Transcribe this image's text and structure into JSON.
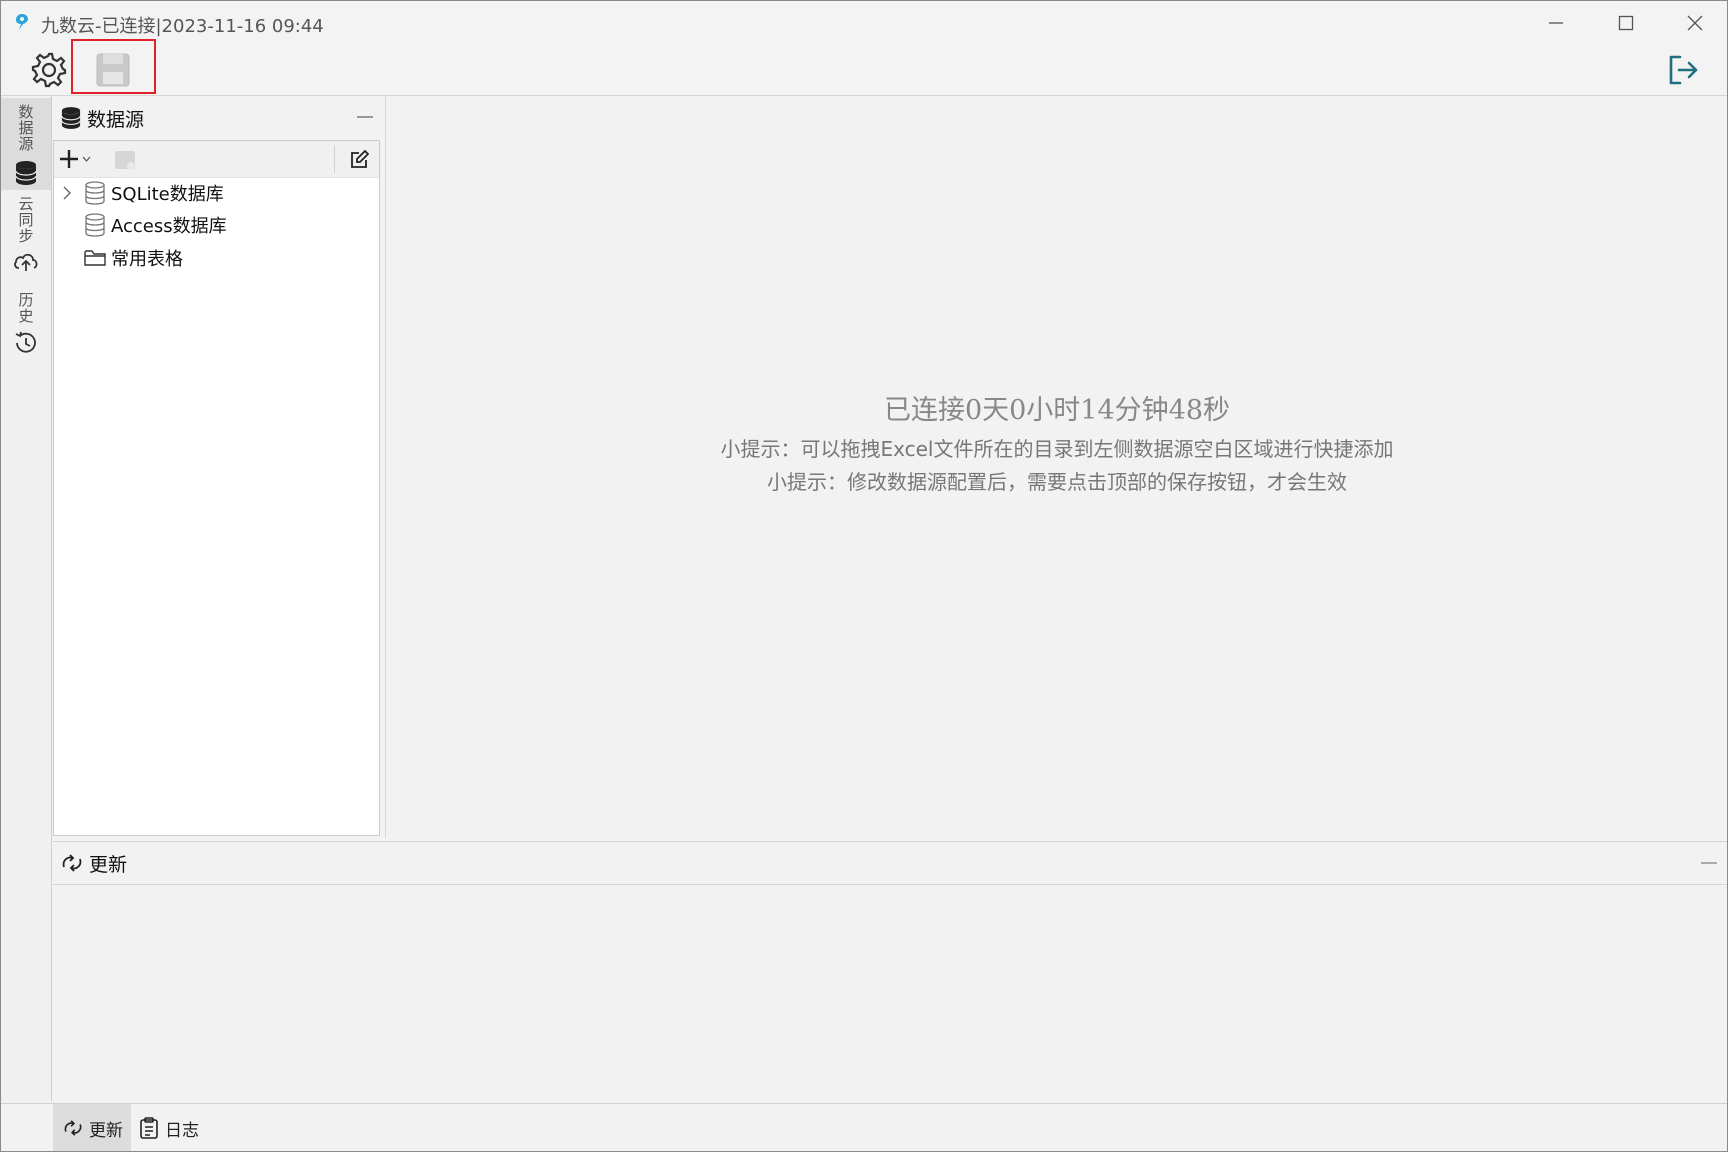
{
  "window": {
    "title": "九数云-已连接|2023-11-16 09:44",
    "controls": [
      "minimize-icon",
      "maximize-icon",
      "close-icon"
    ]
  },
  "toolbar": {
    "buttons": [
      "gear-icon",
      "save-icon"
    ],
    "right_button": "logout-icon",
    "highlight_color": "#e0202a"
  },
  "left_nav": {
    "tabs": [
      {
        "label": "数据源",
        "icon": "database-icon",
        "active": true
      },
      {
        "label": "云同步",
        "icon": "cloud-sync-icon",
        "active": false
      },
      {
        "label": "历史",
        "icon": "history-icon",
        "active": false
      }
    ]
  },
  "datasource_panel": {
    "title": "数据源",
    "tree": [
      {
        "label": "SQLite数据库",
        "icon": "database-icon",
        "expandable": true
      },
      {
        "label": "Access数据库",
        "icon": "database-icon",
        "expandable": false
      },
      {
        "label": "常用表格",
        "icon": "folder-icon",
        "expandable": false
      }
    ]
  },
  "main": {
    "status": "已连接0天0小时14分钟48秒",
    "hint1": "小提示：可以拖拽Excel文件所在的目录到左侧数据源空白区域进行快捷添加",
    "hint2": "小提示：修改数据源配置后，需要点击顶部的保存按钮，才会生效"
  },
  "update_panel": {
    "title": "更新"
  },
  "bottom_tabs": [
    {
      "label": "更新",
      "icon": "update-icon",
      "active": true
    },
    {
      "label": "日志",
      "icon": "log-icon",
      "active": false
    }
  ]
}
